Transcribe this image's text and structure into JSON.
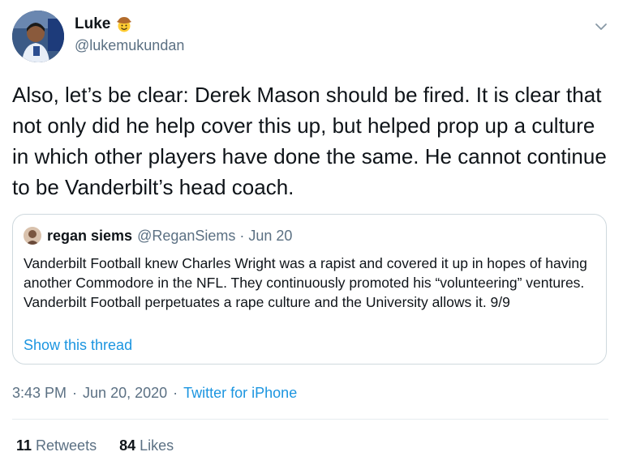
{
  "author": {
    "name": "Luke",
    "handle": "@lukemukundan",
    "emoji_icon": "cowboy-hat-face-icon"
  },
  "tweet": {
    "text": "Also, let’s be clear: Derek Mason should be fired. It is clear that not only did he help cover this up, but helped prop up a culture in which other players have done the same. He cannot continue to be Vanderbilt’s head coach."
  },
  "quote": {
    "name": "regan siems",
    "handle": "@ReganSiems",
    "separator": "·",
    "date": "Jun 20",
    "text": "Vanderbilt Football knew Charles Wright was a rapist and covered it up in hopes of having another Commodore in the NFL. They continuously promoted his “volunteering” ventures. Vanderbilt Football perpetuates a rape culture and the University allows it. 9/9",
    "show_thread": "Show this thread"
  },
  "meta": {
    "time": "3:43 PM",
    "separator": "·",
    "date": "Jun 20, 2020",
    "source": "Twitter for iPhone"
  },
  "stats": {
    "retweets_count": "11",
    "retweets_label": "Retweets",
    "likes_count": "84",
    "likes_label": "Likes"
  },
  "colors": {
    "link": "#1b95e0",
    "secondary_text": "#5b7083",
    "border": "#cfd9de"
  }
}
